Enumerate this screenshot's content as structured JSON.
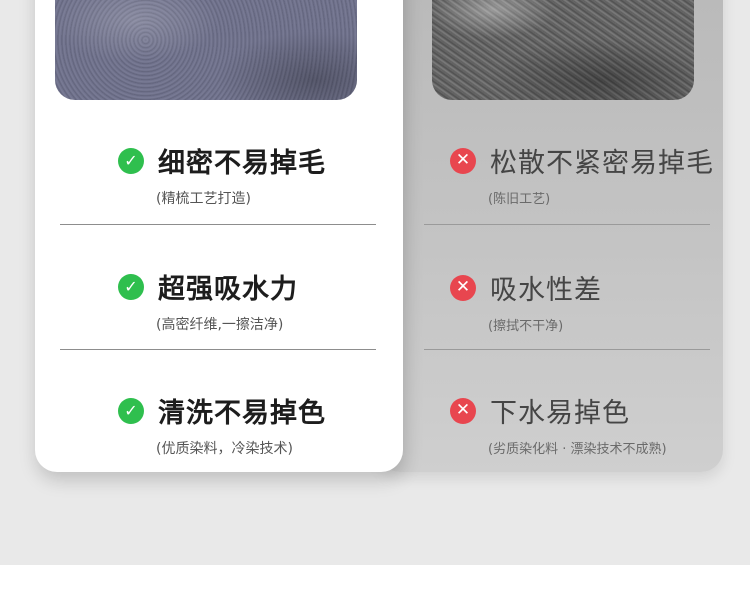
{
  "good": {
    "items": [
      {
        "title": "细密不易掉毛",
        "sub": "(精梳工艺打造)"
      },
      {
        "title": "超强吸水力",
        "sub": "(高密纤维,一擦洁净)"
      },
      {
        "title": "清洗不易掉色",
        "sub": "(优质染料，冷染技术)"
      }
    ],
    "icon_glyph": "✓",
    "accent": "#2fbf4e"
  },
  "bad": {
    "items": [
      {
        "title": "松散不紧密易掉毛",
        "sub": "(陈旧工艺)"
      },
      {
        "title": "吸水性差",
        "sub": "(擦拭不干净)"
      },
      {
        "title": "下水易掉色",
        "sub": "(劣质染化料 · 漂染技术不成熟)"
      }
    ],
    "icon_glyph": "✕",
    "accent": "#e8464f"
  },
  "icons": {
    "good": "check-circle-icon",
    "bad": "x-circle-icon"
  }
}
